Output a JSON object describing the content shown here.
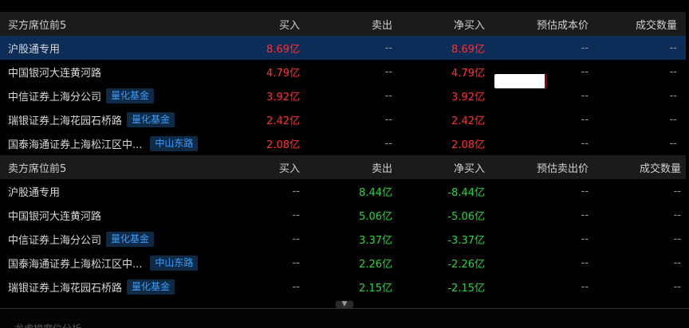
{
  "buy_section": {
    "headers": [
      "买方席位前5",
      "买入",
      "卖出",
      "净买入",
      "预估成本价",
      "成交数量"
    ],
    "rows": [
      {
        "name": "沪股通专用",
        "tag": "",
        "buy": "8.69亿",
        "sell": "--",
        "net": "8.69亿",
        "price": "--",
        "volume": "--",
        "selected": true
      },
      {
        "name": "中国银河大连黄河路",
        "tag": "",
        "buy": "4.79亿",
        "sell": "--",
        "net": "4.79亿",
        "price": "--",
        "volume": "--"
      },
      {
        "name": "中信证券上海分公司",
        "tag": "量化基金",
        "buy": "3.92亿",
        "sell": "--",
        "net": "3.92亿",
        "price": "--",
        "volume": "--"
      },
      {
        "name": "瑞银证券上海花园石桥路",
        "tag": "量化基金",
        "buy": "2.42亿",
        "sell": "--",
        "net": "2.42亿",
        "price": "--",
        "volume": "--"
      },
      {
        "name": "国泰海通证券上海松江区中...",
        "tag": "中山东路",
        "buy": "2.08亿",
        "sell": "--",
        "net": "2.08亿",
        "price": "--",
        "volume": "--"
      }
    ]
  },
  "sell_section": {
    "headers": [
      "卖方席位前5",
      "买入",
      "卖出",
      "净买入",
      "预估卖出价",
      "成交数量"
    ],
    "rows": [
      {
        "name": "沪股通专用",
        "tag": "",
        "buy": "--",
        "sell": "8.44亿",
        "net": "-8.44亿",
        "price": "--",
        "volume": "--"
      },
      {
        "name": "中国银河大连黄河路",
        "tag": "",
        "buy": "--",
        "sell": "5.06亿",
        "net": "-5.06亿",
        "price": "--",
        "volume": "--"
      },
      {
        "name": "中信证券上海分公司",
        "tag": "量化基金",
        "buy": "--",
        "sell": "3.37亿",
        "net": "-3.37亿",
        "price": "--",
        "volume": "--"
      },
      {
        "name": "国泰海通证券上海松江区中...",
        "tag": "中山东路",
        "buy": "--",
        "sell": "2.26亿",
        "net": "-2.26亿",
        "price": "--",
        "volume": "--"
      },
      {
        "name": "瑞银证券上海花园石桥路",
        "tag": "量化基金",
        "buy": "--",
        "sell": "2.15亿",
        "net": "-2.15亿",
        "price": "--",
        "volume": "--"
      }
    ]
  },
  "colors": {
    "up": "#ff3030",
    "down": "#2ed23e",
    "tag_text": "#3b9cff",
    "tag_bg": "#0f2a44",
    "selected_row": "#0b2d57"
  },
  "icons": {
    "expand": "chevron-down-icon"
  },
  "bottom": {
    "text": "龙虎榜席位分析"
  }
}
